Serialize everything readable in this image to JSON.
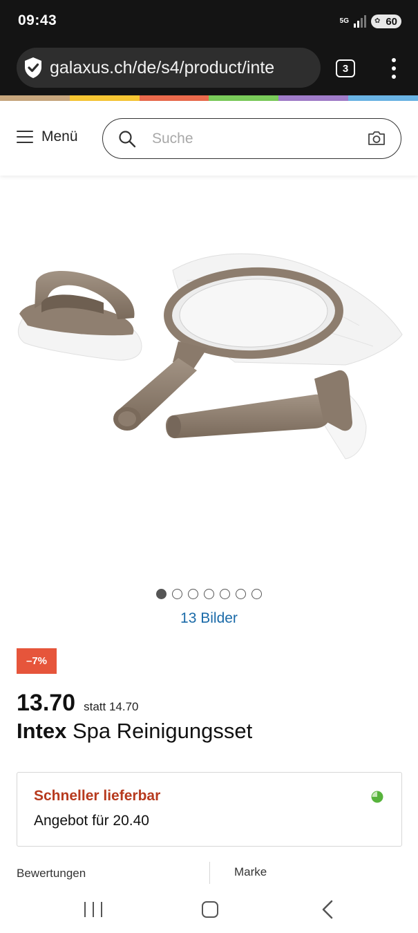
{
  "status_bar": {
    "time": "09:43",
    "network": "5G",
    "battery": "60",
    "icons": [
      "5g-icon",
      "signal-icon",
      "battery-icon"
    ]
  },
  "browser": {
    "url": "galaxus.ch/de/s4/product/inte",
    "tab_count": "3"
  },
  "brand_colors": [
    "#c8a77e",
    "#f7c633",
    "#ea6a4c",
    "#7acb5a",
    "#a07cc9",
    "#6ab4e5"
  ],
  "header": {
    "menu_label": "Menü",
    "search_placeholder": "Suche"
  },
  "gallery": {
    "dot_count": 7,
    "active_index": 0,
    "image_count_label": "13 Bilder"
  },
  "product": {
    "discount": "–7%",
    "price": "13.70",
    "old_price": "statt 14.70",
    "brand": "Intex",
    "name": " Spa Reinigungsset"
  },
  "offer": {
    "title": "Schneller lieferbar",
    "subtitle": "Angebot für 20.40",
    "stock_color": "#57b33c"
  },
  "info_tabs": {
    "left": "Bewertungen",
    "right": "Marke"
  },
  "colors": {
    "accent_red": "#e6553b",
    "offer_title": "#b73a1e",
    "link_blue": "#1a6aa8"
  }
}
